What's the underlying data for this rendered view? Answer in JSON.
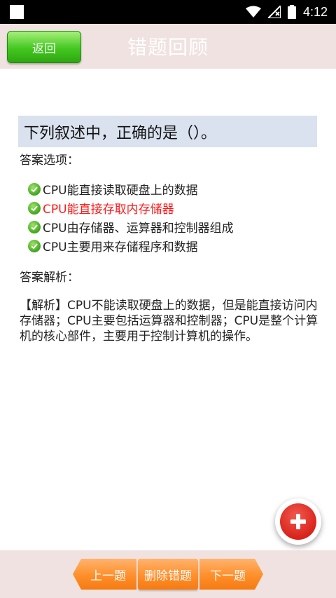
{
  "status_bar": {
    "time": "4:12"
  },
  "header": {
    "back_label": "返回",
    "title": "错题回顾"
  },
  "question": {
    "text": "下列叙述中，正确的是（）。"
  },
  "answer_options_label": "答案选项：",
  "options": [
    {
      "text": "CPU能直接读取硬盘上的数据",
      "highlight": false
    },
    {
      "text": "CPU能直接存取内存储器",
      "highlight": true
    },
    {
      "text": "CPU由存储器、运算器和控制器组成",
      "highlight": false
    },
    {
      "text": "CPU主要用来存储程序和数据",
      "highlight": false
    }
  ],
  "analysis_label": "答案解析：",
  "analysis_text": "【解析】CPU不能读取硬盘上的数据，但是能直接访问内存储器；CPU主要包括运算器和控制器；CPU是整个计算机的核心部件，主要用于控制计算机的操作。",
  "bottom_nav": {
    "prev_label": "上一题",
    "delete_label": "删除错题",
    "next_label": "下一题"
  },
  "colors": {
    "header_bg": "#efe2e0",
    "accent_green": "#43c71f",
    "accent_orange": "#ff8f2a",
    "wrong_red": "#ff1a1a",
    "question_bg": "#d9e2ee"
  },
  "icons": {
    "fab": "plus-icon",
    "option_mark": "check-circle-icon"
  }
}
